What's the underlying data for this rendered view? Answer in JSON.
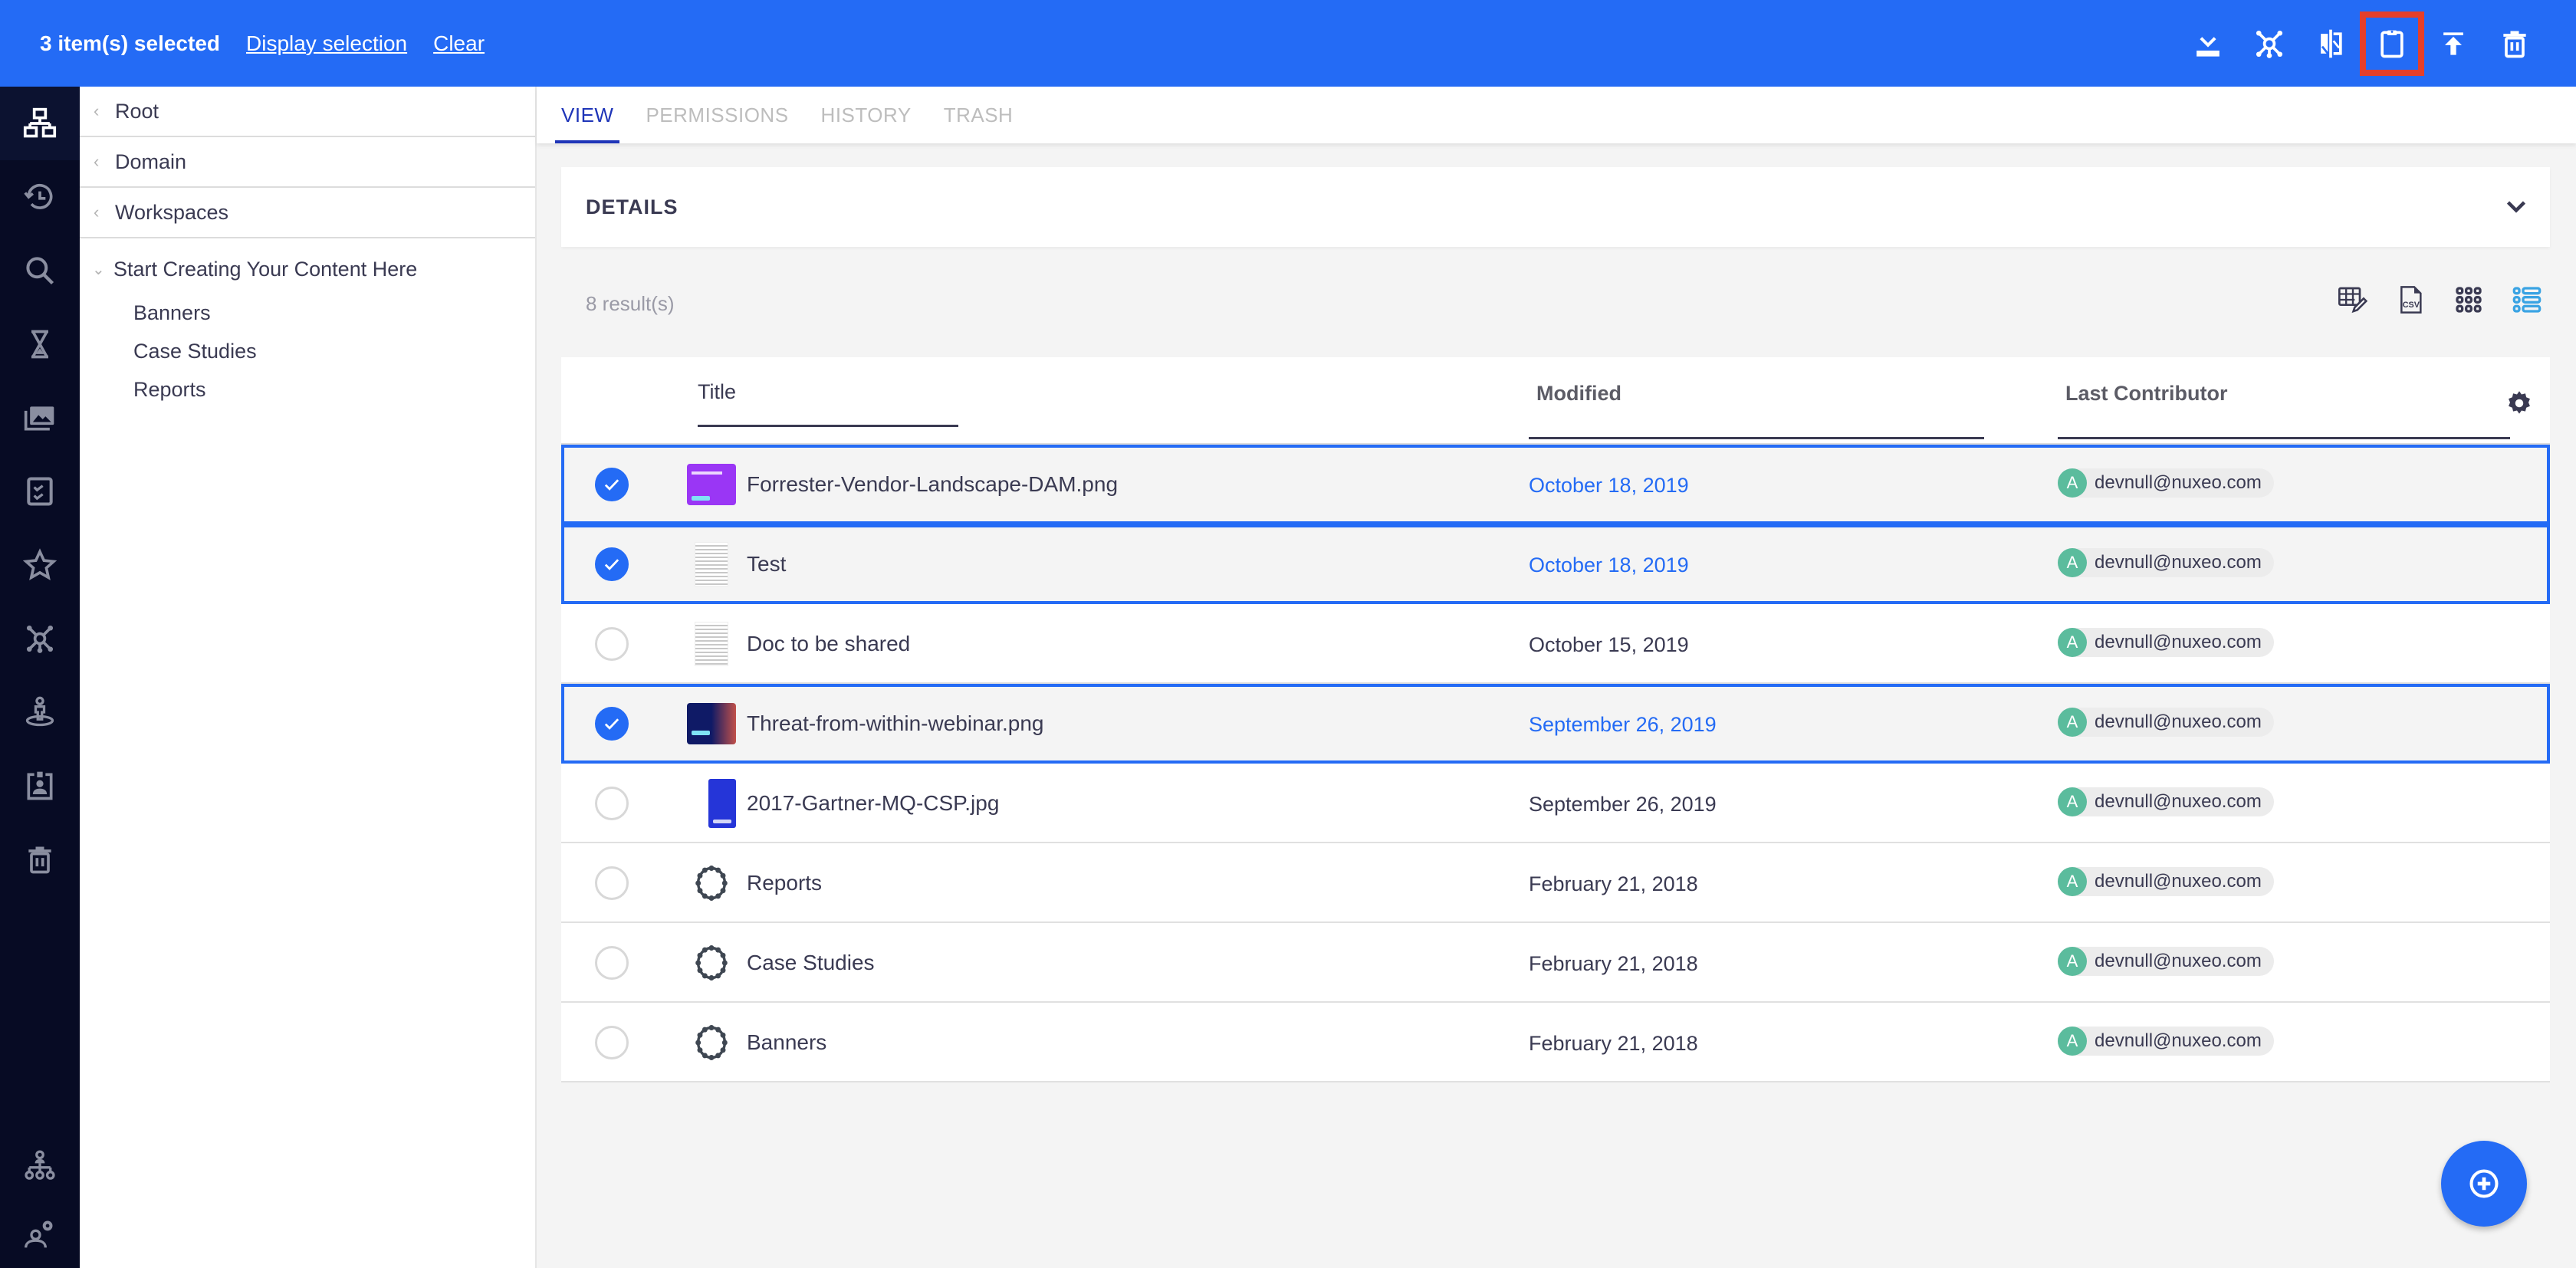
{
  "header": {
    "selection_count": "3 item(s) selected",
    "display_selection": "Display selection",
    "clear": "Clear",
    "actions": [
      {
        "name": "download",
        "icon": "download-icon"
      },
      {
        "name": "add-to-collection",
        "icon": "collection-icon"
      },
      {
        "name": "compare",
        "icon": "compare-icon"
      },
      {
        "name": "add-to-clipboard",
        "icon": "clipboard-icon",
        "highlighted": true
      },
      {
        "name": "move-to-top",
        "icon": "upload-icon"
      },
      {
        "name": "delete",
        "icon": "trash-icon"
      }
    ],
    "highlight_color": "#e53f2a"
  },
  "rail": {
    "items": [
      {
        "name": "browse",
        "icon": "sitemap-icon",
        "active": true
      },
      {
        "name": "recently-viewed",
        "icon": "history-icon"
      },
      {
        "name": "search",
        "icon": "search-icon"
      },
      {
        "name": "expired",
        "icon": "hourglass-icon"
      },
      {
        "name": "assets",
        "icon": "images-icon"
      },
      {
        "name": "tasks",
        "icon": "tasks-icon"
      },
      {
        "name": "favorites",
        "icon": "star-icon"
      },
      {
        "name": "collections",
        "icon": "collection-icon"
      },
      {
        "name": "personal-workspace",
        "icon": "personal-icon"
      },
      {
        "name": "clipboard",
        "icon": "badge-icon"
      },
      {
        "name": "trash",
        "icon": "trash-icon"
      },
      {
        "name": "administration",
        "icon": "org-icon"
      },
      {
        "name": "user-settings",
        "icon": "user-settings-icon"
      }
    ]
  },
  "tree": {
    "ancestors": [
      "Root",
      "Domain",
      "Workspaces"
    ],
    "current": "Start Creating Your Content Here",
    "children": [
      "Banners",
      "Case Studies",
      "Reports"
    ]
  },
  "tabs": [
    {
      "label": "VIEW",
      "active": true
    },
    {
      "label": "PERMISSIONS"
    },
    {
      "label": "HISTORY"
    },
    {
      "label": "TRASH"
    }
  ],
  "details": {
    "label": "DETAILS"
  },
  "results": {
    "count_text": "8 result(s)"
  },
  "view_tools": [
    {
      "name": "edit-columns",
      "icon": "table-edit-icon"
    },
    {
      "name": "export-csv",
      "icon": "csv-icon",
      "text": "CSV"
    },
    {
      "name": "grid-view",
      "icon": "grid-icon"
    },
    {
      "name": "list-view",
      "icon": "list-icon",
      "active": true
    }
  ],
  "table": {
    "columns": {
      "title": "Title",
      "modified": "Modified",
      "last_contributor": "Last Contributor"
    },
    "rows": [
      {
        "title": "Forrester-Vendor-Landscape-DAM.png",
        "modified": "October 18, 2019",
        "avatar": "A",
        "contributor": "devnull@nuxeo.com",
        "selected": true,
        "thumb": "purple"
      },
      {
        "title": "Test",
        "modified": "October 18, 2019",
        "avatar": "A",
        "contributor": "devnull@nuxeo.com",
        "selected": true,
        "thumb": "doc"
      },
      {
        "title": "Doc to be shared",
        "modified": "October 15, 2019",
        "avatar": "A",
        "contributor": "devnull@nuxeo.com",
        "selected": false,
        "thumb": "doc"
      },
      {
        "title": "Threat-from-within-webinar.png",
        "modified": "September 26, 2019",
        "avatar": "A",
        "contributor": "devnull@nuxeo.com",
        "selected": true,
        "thumb": "navy"
      },
      {
        "title": "2017-Gartner-MQ-CSP.jpg",
        "modified": "September 26, 2019",
        "avatar": "A",
        "contributor": "devnull@nuxeo.com",
        "selected": false,
        "thumb": "blue"
      },
      {
        "title": "Reports",
        "modified": "February 21, 2018",
        "avatar": "A",
        "contributor": "devnull@nuxeo.com",
        "selected": false,
        "thumb": "folder"
      },
      {
        "title": "Case Studies",
        "modified": "February 21, 2018",
        "avatar": "A",
        "contributor": "devnull@nuxeo.com",
        "selected": false,
        "thumb": "folder"
      },
      {
        "title": "Banners",
        "modified": "February 21, 2018",
        "avatar": "A",
        "contributor": "devnull@nuxeo.com",
        "selected": false,
        "thumb": "folder"
      }
    ]
  },
  "fab": {
    "name": "create",
    "icon": "add-circle-icon"
  },
  "colors": {
    "primary": "#246bf5",
    "rail_bg": "#070b24",
    "tab_active": "#1f35b8",
    "avatar": "#5bbc9d"
  }
}
